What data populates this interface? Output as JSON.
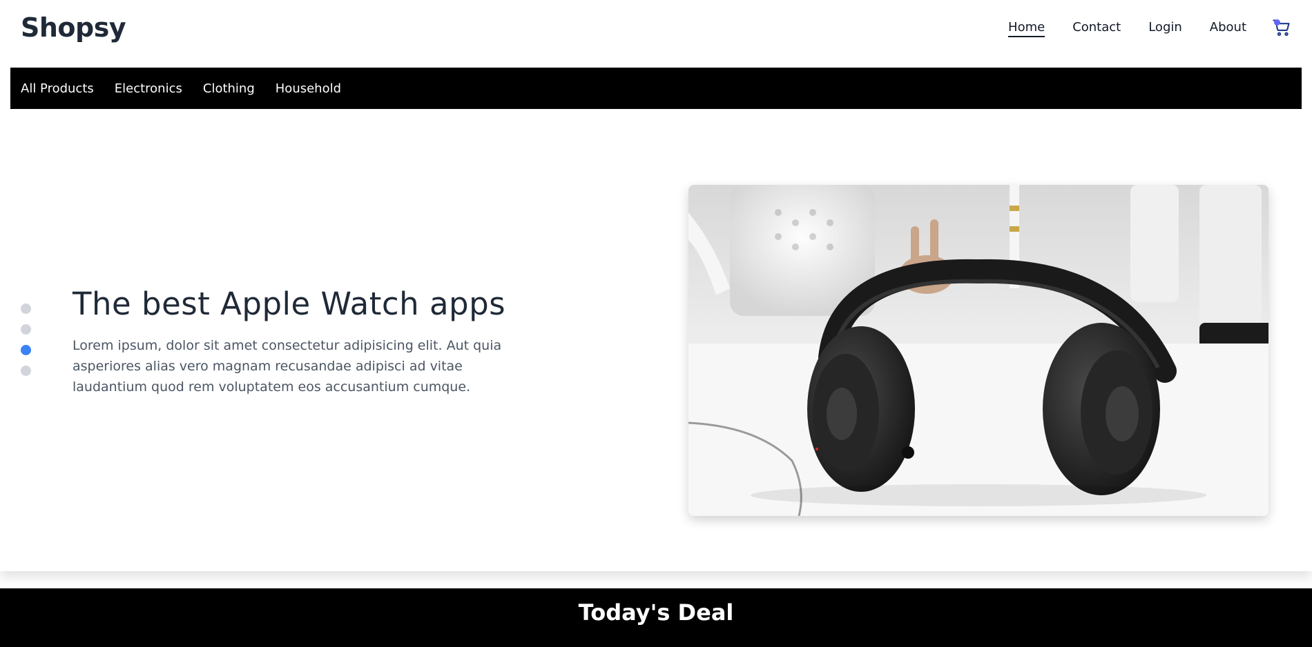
{
  "header": {
    "logo": "Shopsy",
    "nav": [
      {
        "label": "Home",
        "active": true
      },
      {
        "label": "Contact",
        "active": false
      },
      {
        "label": "Login",
        "active": false
      },
      {
        "label": "About",
        "active": false
      }
    ],
    "cart_icon": "shopping-cart-icon",
    "cart_badge_color": "#6366f1"
  },
  "categories": [
    "All Products",
    "Electronics",
    "Clothing",
    "Household"
  ],
  "hero": {
    "title": "The best Apple Watch apps",
    "description": "Lorem ipsum, dolor sit amet consectetur adipisicing elit. Aut quia asperiores alias vero magnam recusandae adipisci ad vitae laudantium quod rem voluptatem eos accusantium cumque.",
    "slide_count": 4,
    "active_slide": 3,
    "image": "headphones-photo",
    "dot_active_color": "#3b82f6",
    "dot_inactive_color": "#d1d5db"
  },
  "deal": {
    "title": "Today's Deal"
  }
}
